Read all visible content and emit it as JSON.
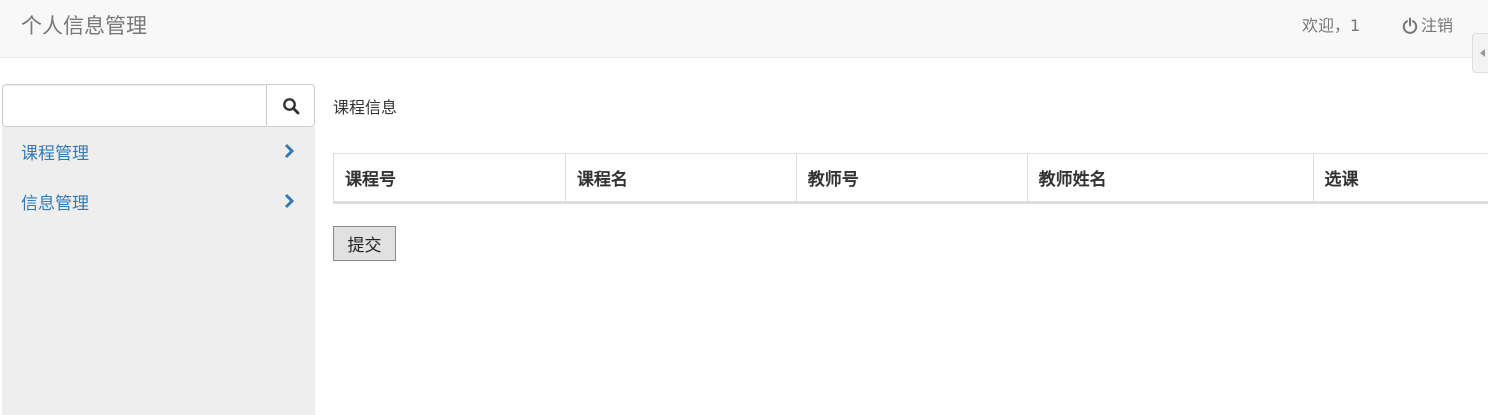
{
  "header": {
    "brand": "个人信息管理",
    "welcome": "欢迎，1",
    "logout_label": "注销"
  },
  "sidebar": {
    "search": {
      "value": "",
      "placeholder": ""
    },
    "items": [
      {
        "label": "课程管理",
        "icon": "chevron-right-icon"
      },
      {
        "label": "信息管理",
        "icon": "chevron-right-icon"
      }
    ]
  },
  "main": {
    "title": "课程信息",
    "table": {
      "columns": [
        "课程号",
        "课程名",
        "教师号",
        "教师姓名",
        "选课"
      ],
      "rows": []
    },
    "submit_label": "提交"
  },
  "colors": {
    "link": "#337ab7",
    "navbar_bg": "#f8f8f8",
    "sidebar_bg": "#eeeeee",
    "muted_text": "#777777"
  }
}
